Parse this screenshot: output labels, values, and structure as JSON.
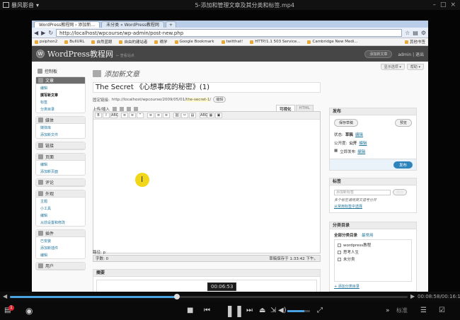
{
  "player": {
    "logo": "暴风影音",
    "file_title": "5-添加和管理文章及其分类和标签.mp4",
    "win_buttons": [
      "–",
      "□",
      "×"
    ],
    "tooltip_time": "00:06:53",
    "time_display": "00:08:58/00:16:18",
    "progress": 0.42,
    "volume": 0.75,
    "badge_count": "1",
    "mode_label": "标准",
    "seek_left": "◀",
    "seek_right": "▶"
  },
  "browser": {
    "tabs": [
      "WordPress教程网 › 添加新...",
      "未分类 « WordPress教程网",
      "+"
    ],
    "url": "http://localhost/wpcourse/wp-admin/post-new.php",
    "bookmarks": [
      "psiphon2",
      "BullURL",
      "自然蓝眼",
      "自由的建站者",
      "嘀学",
      "Google Bookmark",
      "twitthat!",
      "HTTP/1.1 503 Service...",
      "Cambridge New Medi..."
    ],
    "other_bookmarks": "其他书签"
  },
  "wp": {
    "site_name": "WordPress教程网",
    "visit_site": "← 查看站点",
    "fav_actions": "添加新文章",
    "user_links": "admin | 退出",
    "screen_options": [
      "显示选项 ▾",
      "帮助 ▾"
    ],
    "page_title": "添加新文章",
    "post_title": "The Secret 《心想事成的秘密》(1)",
    "permalink_label": "固定链接:",
    "permalink_base": "http://localhost/wpcourse/2009/05/01/",
    "permalink_slug": "the-secret-1",
    "permalink_end": "/",
    "edit_btn": "编辑",
    "upload_label": "上传/插入",
    "editor_tabs": [
      "可视化",
      "HTML"
    ],
    "toolbar": [
      "B",
      "I",
      "ABC",
      "≡",
      "≡",
      "“",
      "≡",
      "≡",
      "≡",
      "⛓",
      "✂",
      "▤",
      "ABC",
      "▦",
      "▣"
    ],
    "path": "路径: p",
    "word_count": "字数: 0",
    "draft_saved": "草稿保存于 1:33:42 下午。",
    "excerpt_title": "摘要",
    "sidebar": {
      "dashboard": "控制板",
      "menus": [
        {
          "head": "文章",
          "active": true,
          "subs": [
            "编辑",
            "撰写新文章",
            "标签",
            "分类目录"
          ]
        },
        {
          "head": "媒体",
          "active": false,
          "subs": [
            "媒体库",
            "添加新文件"
          ]
        },
        {
          "head": "链接",
          "active": false,
          "subs": []
        },
        {
          "head": "页面",
          "active": false,
          "subs": [
            "编辑",
            "添加新页面"
          ]
        },
        {
          "head": "评论",
          "active": false,
          "subs": []
        },
        {
          "head": "外观",
          "active": false,
          "subs": [
            "主题",
            "小工具",
            "编辑",
            "从前设置和修改"
          ]
        },
        {
          "head": "插件",
          "active": false,
          "subs": [
            "已安装",
            "添加新插件",
            "编辑"
          ]
        },
        {
          "head": "用户",
          "active": false,
          "subs": []
        }
      ]
    },
    "publish": {
      "title": "发布",
      "save_draft": "保存草稿",
      "preview": "预览",
      "status_label": "状态:",
      "status_value": "草稿",
      "visibility_label": "公开度:",
      "visibility_value": "公开",
      "schedule_label": "立即发布",
      "edit_link": "编辑",
      "publish_btn": "发布"
    },
    "tags": {
      "title": "标签",
      "placeholder": "添加新标签",
      "add_btn": "添加",
      "note": "多个标签请用英文逗号分开",
      "choose_link": "从常用标签中选择"
    },
    "categories": {
      "title": "分类目录",
      "tab_all": "全部分类目录",
      "tab_used": "最常用",
      "items": [
        "wordpress教程",
        "思考人生",
        "未分类"
      ],
      "add_link": "+ 添加分类目录"
    }
  },
  "colors": {
    "accent": "#4aa3e0",
    "wp_header": "#464646",
    "publish_button": "#2e85bb",
    "cursor_highlight": "#f1d200"
  }
}
